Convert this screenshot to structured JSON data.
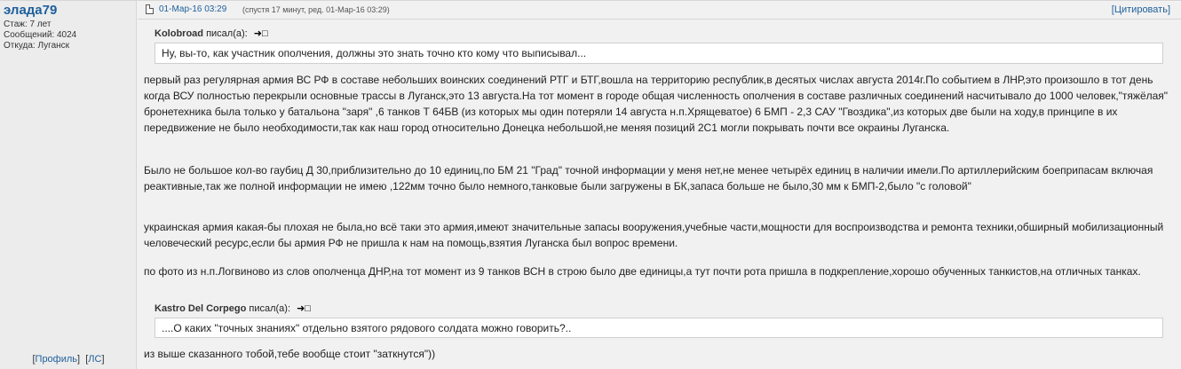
{
  "user": {
    "name": "элада79",
    "tenure": "Стаж: 7 лет",
    "messages": "Сообщений: 4024",
    "location": "Откуда: Луганск",
    "profile_link": "Профиль",
    "pm_link": "ЛС"
  },
  "post": {
    "date": "01-Мар-16 03:29",
    "edit_note": "(спустя 17 минут, ред. 01-Мар-16 03:29)",
    "quote_button": "Цитировать"
  },
  "quote1": {
    "author": "Kolobroad",
    "wrote": "писал(а):",
    "arrow": "➜□",
    "text": "Ну, вы-то, как участник ополчения, должны это знать точно кто кому что выписывал..."
  },
  "paragraphs": [
    "первый раз регулярная армия ВС РФ в составе небольших воинских соединений РТГ и БТГ,вошла на территорию республик,в десятых числах августа 2014г.По событием в ЛНР,это произошло в тот день когда ВСУ полностью перекрыли основные трассы в Луганск,это 13 августа.На тот момент в городе общая численность ополчения в составе различных соединений насчитывало до 1000 человек,\"тяжёлая\" бронетехника была только у батальона \"заря\" ,6 танков Т 64БВ (из которых мы один потеряли 14 августа н.п.Хрящеватое) 6 БМП - 2,3 САУ \"Гвоздика\",из которых две были на ходу,в принципе в их передвижение не было необходимости,так как наш город относительно Донецка небольшой,не меняя позиций 2С1 могли покрывать почти все окраины Луганска.",
    "Было не большое кол-во гаубиц Д 30,приблизительно до 10 единиц,по БМ 21 \"Град\" точной информации у меня нет,не менее четырёх единиц в наличии имели.По артиллерийским боеприпасам включая реактивные,так же полной информации не имею ,122мм точно было немного,танковые были загружены в БК,запаса больше не было,30 мм к БМП-2,было \"с головой\"",
    "украинская армия какая-бы плохая не была,но всё таки это армия,имеют значительные запасы вооружения,учебные части,мощности для воспроизводства и ремонта техники,обширный мобилизационный человеческий ресурс,если бы армия РФ не пришла к нам на помощь,взятия Луганска был вопрос времени.",
    "по фото из н.п.Логвиново из слов ополченца ДНР,на тот момент из 9 танков ВСН в строю было две единицы,а тут почти рота пришла в подкрепление,хорошо обученных танкистов,на отличных танках."
  ],
  "quote2": {
    "author": "Kastro Del Corpego",
    "wrote": "писал(а):",
    "arrow": "➜□",
    "text": "....О каких \"точных знаниях\" отдельно взятого рядового солдата можно говорить?.."
  },
  "last_paragraph": "из выше сказанного тобой,тебе вообще стоит \"заткнутся\"))"
}
